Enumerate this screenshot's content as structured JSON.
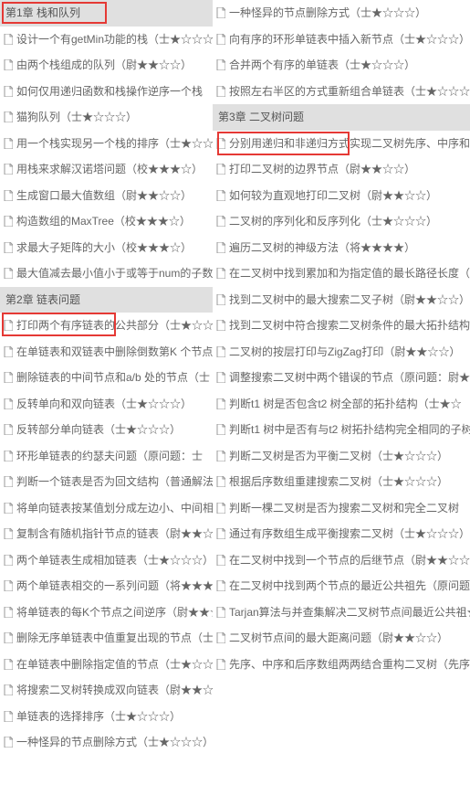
{
  "left": [
    {
      "type": "chapter",
      "label": "第1章 栈和队列"
    },
    {
      "type": "item",
      "label": "设计一个有getMin功能的栈（士★☆☆☆）"
    },
    {
      "type": "item",
      "label": "由两个栈组成的队列（尉★★☆☆）"
    },
    {
      "type": "item",
      "label": "如何仅用递归函数和栈操作逆序一个栈"
    },
    {
      "type": "item",
      "label": "猫狗队列（士★☆☆☆）"
    },
    {
      "type": "item",
      "label": "用一个栈实现另一个栈的排序（士★☆☆☆）"
    },
    {
      "type": "item",
      "label": "用栈来求解汉诺塔问题（校★★★☆）"
    },
    {
      "type": "item",
      "label": "生成窗口最大值数组（尉★★☆☆）"
    },
    {
      "type": "item",
      "label": "构造数组的MaxTree（校★★★☆）"
    },
    {
      "type": "item",
      "label": "求最大子矩阵的大小（校★★★☆）"
    },
    {
      "type": "item",
      "label": "最大值减去最小值小于或等于num的子数"
    },
    {
      "type": "chapter",
      "label": "第2章 链表问题"
    },
    {
      "type": "item",
      "label": "打印两个有序链表的公共部分（士★☆☆☆）"
    },
    {
      "type": "item",
      "label": "在单链表和双链表中删除倒数第K 个节点"
    },
    {
      "type": "item",
      "label": "删除链表的中间节点和a/b 处的节点（士"
    },
    {
      "type": "item",
      "label": "反转单向和双向链表（士★☆☆☆）"
    },
    {
      "type": "item",
      "label": "反转部分单向链表（士★☆☆☆）"
    },
    {
      "type": "item",
      "label": "环形单链表的约瑟夫问题（原问题：士"
    },
    {
      "type": "item",
      "label": "判断一个链表是否为回文结构（普通解法"
    },
    {
      "type": "item",
      "label": "将单向链表按某值划分成左边小、中间相"
    },
    {
      "type": "item",
      "label": "复制含有随机指针节点的链表（尉★★☆"
    },
    {
      "type": "item",
      "label": "两个单链表生成相加链表（士★☆☆☆）"
    },
    {
      "type": "item",
      "label": "两个单链表相交的一系列问题（将★★★"
    },
    {
      "type": "item",
      "label": "将单链表的每K个节点之间逆序（尉★★☆"
    },
    {
      "type": "item",
      "label": "删除无序单链表中值重复出现的节点（士"
    },
    {
      "type": "item",
      "label": "在单链表中删除指定值的节点（士★☆☆"
    },
    {
      "type": "item",
      "label": "将搜索二叉树转换成双向链表（尉★★☆"
    },
    {
      "type": "item",
      "label": "单链表的选择排序（士★☆☆☆）"
    },
    {
      "type": "item",
      "label": "一种怪异的节点删除方式（士★☆☆☆）"
    }
  ],
  "right": [
    {
      "type": "item",
      "label": "一种怪异的节点删除方式（士★☆☆☆）"
    },
    {
      "type": "item",
      "label": "向有序的环形单链表中插入新节点（士★☆☆☆）"
    },
    {
      "type": "item",
      "label": "合并两个有序的单链表（士★☆☆☆）"
    },
    {
      "type": "item",
      "label": "按照左右半区的方式重新组合单链表（士★☆☆☆）"
    },
    {
      "type": "chapter",
      "label": "第3章 二叉树问题"
    },
    {
      "type": "item",
      "label": "分别用递归和非递归方式实现二叉树先序、中序和"
    },
    {
      "type": "item",
      "label": "打印二叉树的边界节点（尉★★☆☆）"
    },
    {
      "type": "item",
      "label": "如何较为直观地打印二叉树（尉★★☆☆）"
    },
    {
      "type": "item",
      "label": "二叉树的序列化和反序列化（士★☆☆☆）"
    },
    {
      "type": "item",
      "label": "遍历二叉树的神级方法（将★★★★）"
    },
    {
      "type": "item",
      "label": "在二叉树中找到累加和为指定值的最长路径长度（"
    },
    {
      "type": "item",
      "label": "找到二叉树中的最大搜索二叉子树（尉★★☆☆）"
    },
    {
      "type": "item",
      "label": "找到二叉树中符合搜索二叉树条件的最大拓扑结构"
    },
    {
      "type": "item",
      "label": "二叉树的按层打印与ZigZag打印（尉★★☆☆）"
    },
    {
      "type": "item",
      "label": "调整搜索二叉树中两个错误的节点（原问题：尉★★★★）"
    },
    {
      "type": "item",
      "label": "判断t1 树是否包含t2 树全部的拓扑结构（士★☆"
    },
    {
      "type": "item",
      "label": "判断t1 树中是否有与t2 树拓扑结构完全相同的子树"
    },
    {
      "type": "item",
      "label": "判断二叉树是否为平衡二叉树（士★☆☆☆）"
    },
    {
      "type": "item",
      "label": "根据后序数组重建搜索二叉树（士★☆☆☆）"
    },
    {
      "type": "item",
      "label": "判断一棵二叉树是否为搜索二叉树和完全二叉树"
    },
    {
      "type": "item",
      "label": "通过有序数组生成平衡搜索二叉树（士★☆☆☆）"
    },
    {
      "type": "item",
      "label": "在二叉树中找到一个节点的后继节点（尉★★☆☆）"
    },
    {
      "type": "item",
      "label": "在二叉树中找到两个节点的最近公共祖先（原问题：尉★★☆☆再进阶问题：校★★★☆）"
    },
    {
      "type": "item",
      "label": "Tarjan算法与并查集解决二叉树节点间最近公共祖★★★☆）"
    },
    {
      "type": "item",
      "label": "二叉树节点间的最大距离问题（尉★★☆☆）"
    },
    {
      "type": "item",
      "label": "先序、中序和后序数组两两结合重构二叉树（先序（中序与后序结合士★☆☆☆先序与后序结合尉★★）"
    }
  ]
}
